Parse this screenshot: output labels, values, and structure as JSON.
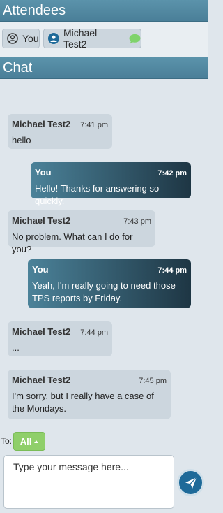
{
  "attendees": {
    "title": "Attendees",
    "people": [
      {
        "name": "You"
      },
      {
        "name": "Michael Test2"
      }
    ]
  },
  "chat": {
    "title": "Chat",
    "messages": [
      {
        "sender": "Michael Test2",
        "time": "7:41 pm",
        "text": "hello",
        "from_me": false
      },
      {
        "sender": "You",
        "time": "7:42 pm",
        "text": "Hello! Thanks for answering so quickly.",
        "from_me": true
      },
      {
        "sender": "Michael Test2",
        "time": "7:43 pm",
        "text": "No problem. What can I do for you?",
        "from_me": false
      },
      {
        "sender": "You",
        "time": "7:44 pm",
        "text": "Yeah, I'm really going to need those TPS reports by Friday.",
        "from_me": true
      },
      {
        "sender": "Michael Test2",
        "time": "7:44 pm",
        "text": "...",
        "from_me": false
      },
      {
        "sender": "Michael Test2",
        "time": "7:45 pm",
        "text": "I'm sorry, but I really have a case of the Mondays.",
        "from_me": false
      }
    ]
  },
  "composer": {
    "to_label": "To:",
    "recipient": "All",
    "placeholder": "Type your message here..."
  },
  "colors": {
    "header": "#5b93ab",
    "recipient_button": "#8fcf6a",
    "send_button": "#1e6a99",
    "chat_icon": "#7fd36b"
  }
}
